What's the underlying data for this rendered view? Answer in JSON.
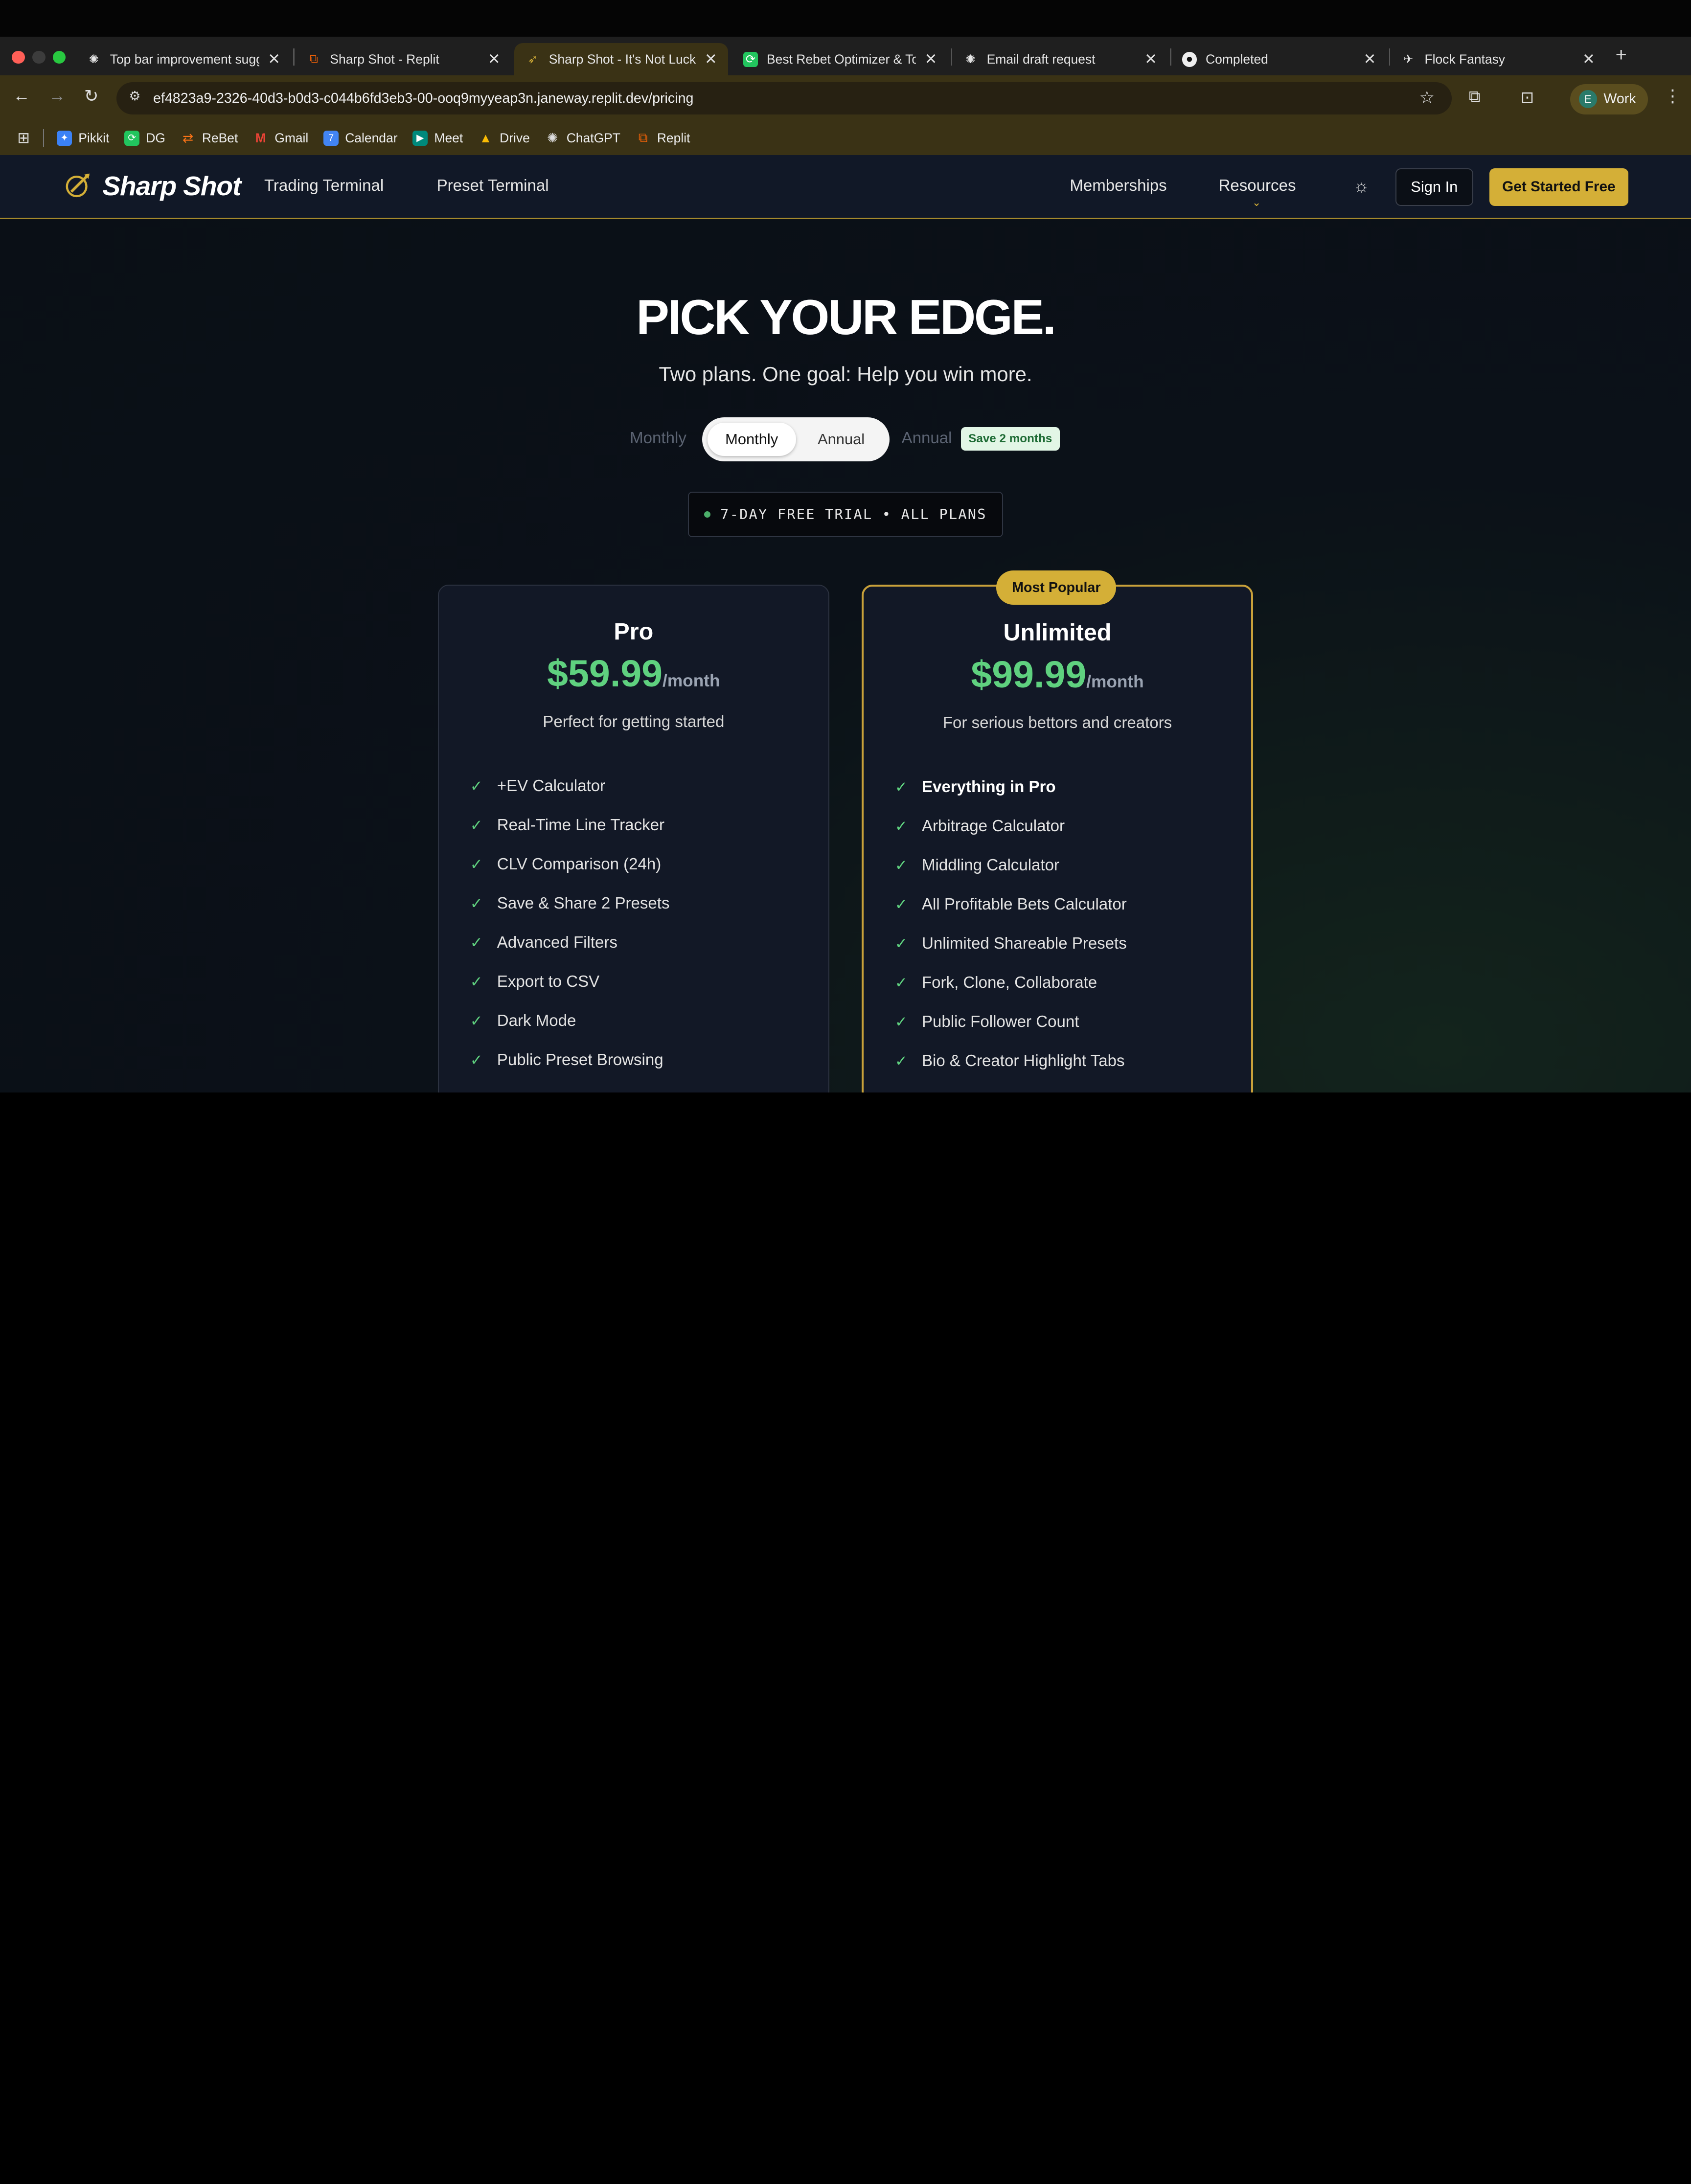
{
  "browser": {
    "tabs": [
      {
        "title": "Top bar improvement sugg",
        "icon": "openai-icon",
        "active": false
      },
      {
        "title": "Sharp Shot - Replit",
        "icon": "replit-icon",
        "active": false
      },
      {
        "title": "Sharp Shot - It's Not Luck",
        "icon": "sharpshot-icon",
        "active": true
      },
      {
        "title": "Best Rebet Optimizer & To",
        "icon": "rebet-icon",
        "active": false
      },
      {
        "title": "Email draft request",
        "icon": "openai-icon",
        "active": false
      },
      {
        "title": "Completed",
        "icon": "github-icon",
        "active": false
      },
      {
        "title": "Flock Fantasy",
        "icon": "bird-icon",
        "active": false
      }
    ],
    "url": "ef4823a9-2326-40d3-b0d3-c044b6fd3eb3-00-ooq9myyeap3n.janeway.replit.dev/pricing",
    "profile": {
      "initial": "E",
      "label": "Work"
    },
    "bookmarks": [
      {
        "label": "Pikkit",
        "color": "#3b82f6"
      },
      {
        "label": "DG",
        "color": "#22c55e"
      },
      {
        "label": "ReBet",
        "color": "#f97316"
      },
      {
        "label": "Gmail",
        "color": "#ea4335"
      },
      {
        "label": "Calendar",
        "color": "#4285f4"
      },
      {
        "label": "Meet",
        "color": "#00897b"
      },
      {
        "label": "Drive",
        "color": "#fbbc04"
      },
      {
        "label": "ChatGPT",
        "color": "#555555"
      },
      {
        "label": "Replit",
        "color": "#f26207"
      }
    ]
  },
  "nav": {
    "brand": "Sharp Shot",
    "links": [
      "Trading Terminal",
      "Preset Terminal"
    ],
    "right_links": [
      "Memberships",
      "Resources"
    ],
    "sign_in": "Sign In",
    "get_started": "Get Started Free"
  },
  "hero": {
    "title": "PICK YOUR EDGE.",
    "subtitle": "Two plans. One goal: Help you win more."
  },
  "billing": {
    "left_label": "Monthly",
    "options": [
      "Monthly",
      "Annual"
    ],
    "selected": "Monthly",
    "right_label": "Annual",
    "badge": "Save 2 months"
  },
  "trial_text": "7-DAY FREE TRIAL • ALL PLANS",
  "plans": {
    "pro": {
      "name": "Pro",
      "price": "$59.99",
      "period": "/month",
      "description": "Perfect for getting started",
      "features": [
        "+EV Calculator",
        "Real-Time Line Tracker",
        "CLV Comparison (24h)",
        "Save & Share 2 Presets",
        "Advanced Filters",
        "Export to CSV",
        "Dark Mode",
        "Public Preset Browsing"
      ]
    },
    "unlimited": {
      "badge": "Most Popular",
      "name": "Unlimited",
      "price": "$99.99",
      "period": "/month",
      "description": "For serious bettors and creators",
      "features": [
        "Everything in Pro",
        "Arbitrage Calculator",
        "Middling Calculator",
        "All Profitable Bets Calculator",
        "Unlimited Shareable Presets",
        "Fork, Clone, Collaborate",
        "Public Follower Count",
        "Bio & Creator Highlight Tabs"
      ]
    }
  },
  "colors": {
    "accent_gold": "#d4af37",
    "price_green": "#5fd17f",
    "nav_bg": "#111827"
  }
}
